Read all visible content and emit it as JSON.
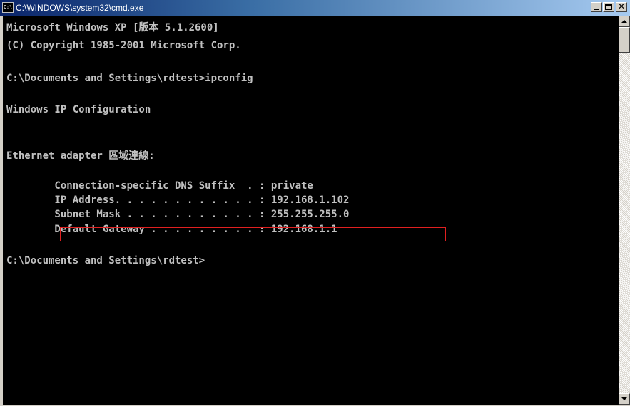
{
  "window": {
    "title": "C:\\WINDOWS\\system32\\cmd.exe",
    "icon_name": "console-icon",
    "icon_text": "C:\\",
    "controls": {
      "minimize_icon": "minimize-icon",
      "maximize_icon": "maximize-icon",
      "close_icon": "close-icon",
      "close_glyph": "✕"
    }
  },
  "console": {
    "colors": {
      "background": "#000000",
      "text": "#c0c0c0",
      "highlight_box": "#e02020"
    },
    "lines": {
      "banner": "Microsoft Windows XP [版本 5.1.2600]",
      "copyright": "(C) Copyright 1985-2001 Microsoft Corp.",
      "command": "C:\\Documents and Settings\\rdtest>ipconfig",
      "ip_config_header": "Windows IP Configuration",
      "adapter": "Ethernet adapter 區域連線:",
      "dns_suffix": "        Connection-specific DNS Suffix  . : private",
      "ip_address": "        IP Address. . . . . . . . . . . . : 192.168.1.102",
      "subnet_mask": "        Subnet Mask . . . . . . . . . . . : 255.255.255.0",
      "default_gateway": "        Default Gateway . . . . . . . . . : 192.168.1.1",
      "prompt": "C:\\Documents and Settings\\rdtest>"
    }
  },
  "scrollbar": {
    "up_icon": "scroll-up-arrow-icon",
    "down_icon": "scroll-down-arrow-icon"
  }
}
